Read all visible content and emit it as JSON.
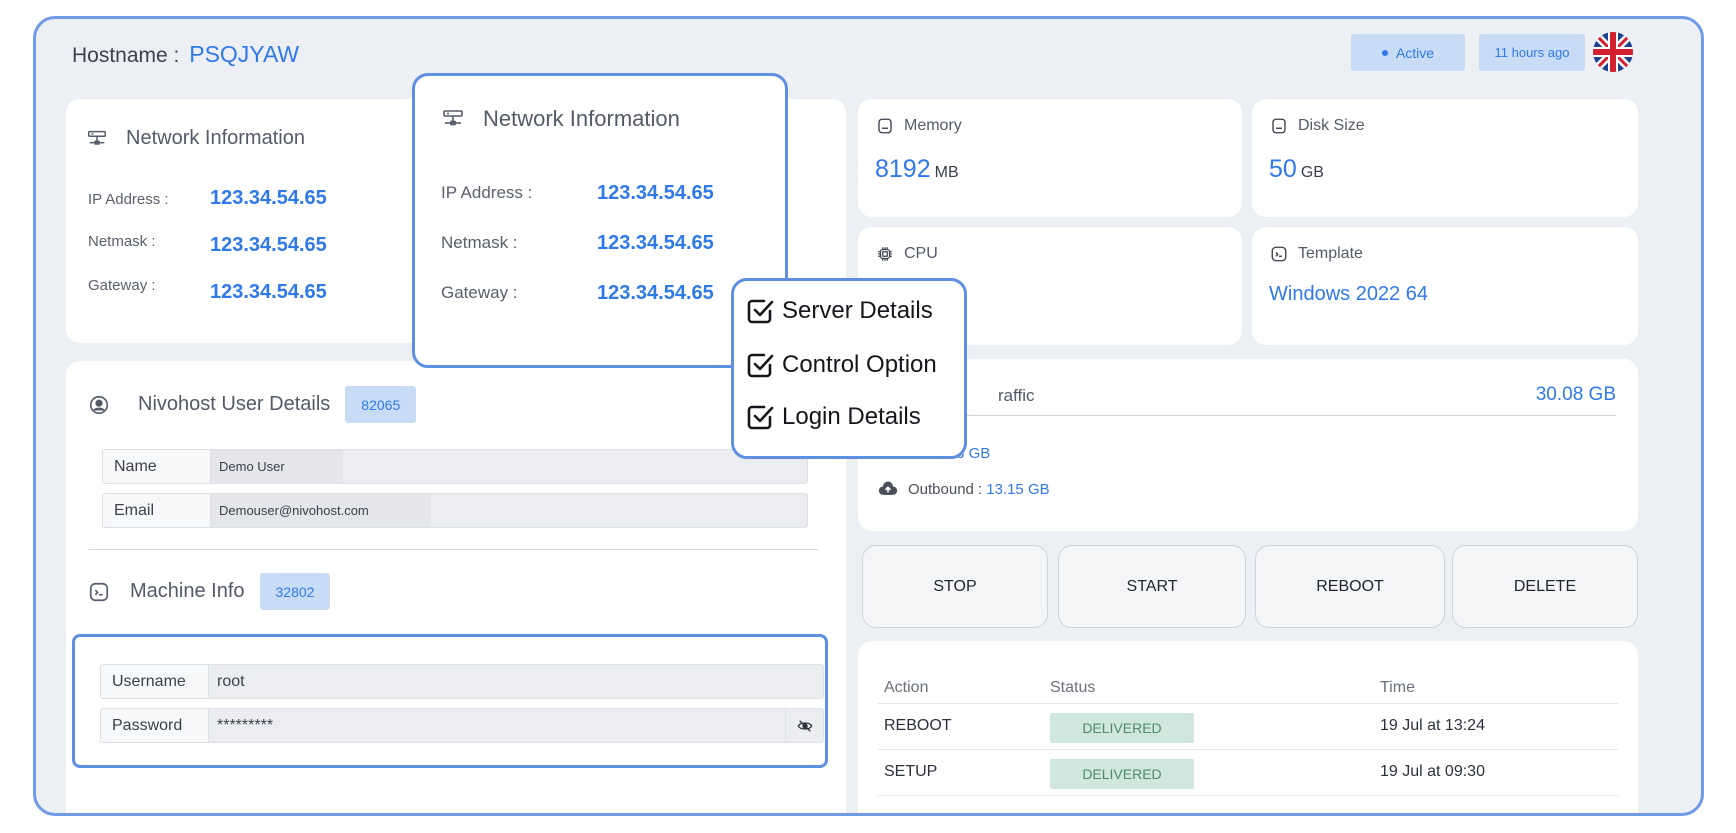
{
  "header": {
    "hostname_label": "Hostname :",
    "hostname_value": "PSQJYAW",
    "status": "Active",
    "last_seen": "11 hours ago",
    "flag_icon": "uk-flag-icon"
  },
  "network": {
    "title": "Network Information",
    "ip_label": "IP Address :",
    "ip_value": "123.34.54.65",
    "netmask_label": "Netmask :",
    "netmask_value": "123.34.54.65",
    "gateway_label": "Gateway :",
    "gateway_value": "123.34.54.65"
  },
  "user_details": {
    "title": "Nivohost User Details",
    "id": "82065",
    "name_label": "Name",
    "name_value": "Demo User",
    "email_label": "Email",
    "email_value": "Demouser@nivohost.com"
  },
  "machine_info": {
    "title": "Machine Info",
    "id": "32802",
    "username_label": "Username",
    "username_value": "root",
    "password_label": "Password",
    "password_value": "*********"
  },
  "stats": {
    "memory_label": "Memory",
    "memory_value": "8192",
    "memory_unit": "MB",
    "disk_label": "Disk Size",
    "disk_value": "50",
    "disk_unit": "GB",
    "cpu_label": "CPU",
    "template_label": "Template",
    "template_value": "Windows 2022 64"
  },
  "traffic": {
    "title_partial": "raffic",
    "total": "30.08 GB",
    "inbound_label_partial": "d :",
    "inbound_value": "16.93 GB",
    "outbound_label": "Outbound :",
    "outbound_value": "13.15 GB"
  },
  "controls": {
    "stop": "STOP",
    "start": "START",
    "reboot": "REBOOT",
    "delete": "DELETE"
  },
  "actions_table": {
    "headers": [
      "Action",
      "Status",
      "Time"
    ],
    "rows": [
      {
        "action": "REBOOT",
        "status": "DELIVERED",
        "time": "19 Jul at 13:24"
      },
      {
        "action": "SETUP",
        "status": "DELIVERED",
        "time": "19 Jul at 09:30"
      }
    ]
  },
  "checklist": {
    "items": [
      "Server Details",
      "Control Option",
      "Login Details"
    ]
  },
  "colors": {
    "accent": "#2f79e8",
    "highlight_border": "#5f8fe0",
    "delivered_bg": "#cfe7dc"
  }
}
